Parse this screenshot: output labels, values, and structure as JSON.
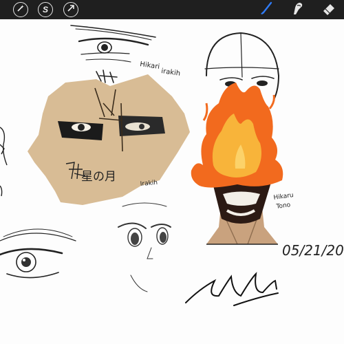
{
  "app": {
    "toolbar_left": [
      {
        "icon": "magic-wand-icon"
      },
      {
        "icon": "selection-s-icon",
        "label": "S"
      },
      {
        "icon": "transform-arrow-icon"
      }
    ],
    "toolbar_right": [
      {
        "icon": "brush-icon",
        "active": true
      },
      {
        "icon": "smudge-icon"
      },
      {
        "icon": "eraser-icon"
      }
    ],
    "colors": {
      "toolbar_bg": "#1f1f1f",
      "active_tool": "#2f7bf5",
      "canvas_bg": "#fdfdfd",
      "skin_tan": "#d8bc95",
      "flame_orange": "#f26a1e",
      "flame_yellow": "#f8b43a"
    }
  },
  "canvas": {
    "annotations": {
      "top_names_line1": "Hikari",
      "top_names_line2": "irakih",
      "kanji_signature": "星の月",
      "tan_face_name": "Irakih",
      "fire_name_line1": "Hikaru",
      "fire_name_line2": "Tono",
      "date_text": "05/21/20"
    }
  }
}
